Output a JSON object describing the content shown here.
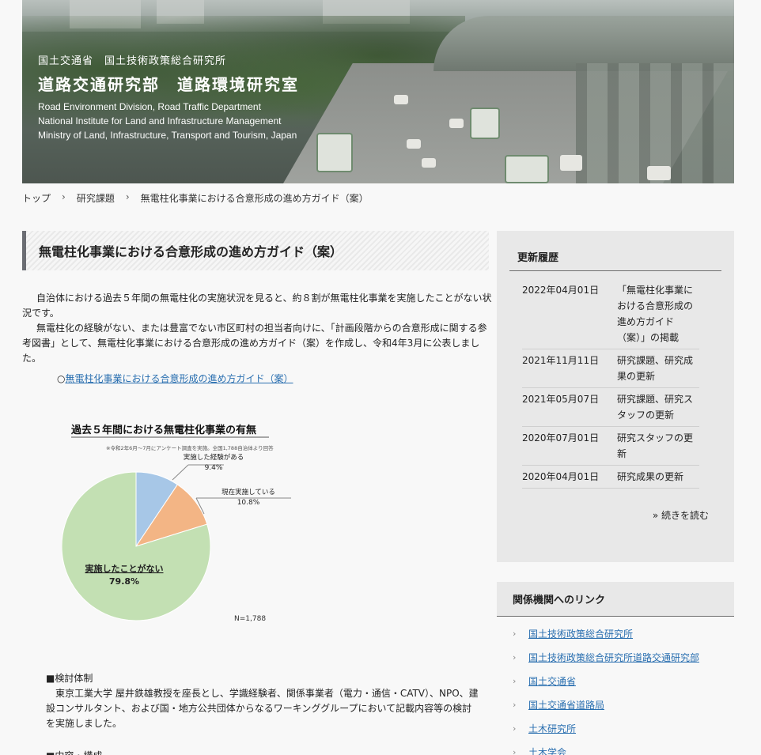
{
  "banner": {
    "org": "国土交通省　国土技術政策総合研究所",
    "dept": "道路交通研究部　道路環境研究室",
    "en_lines": [
      "Road Environment Division,  Road Traffic Department",
      "National Institute for Land and Infrastructure Management",
      "Ministry of Land, Infrastructure, Transport and Tourism, Japan"
    ]
  },
  "breadcrumb": {
    "items": [
      "トップ",
      "研究課題",
      "無電柱化事業における合意形成の進め方ガイド（案）"
    ],
    "sep": "›"
  },
  "main": {
    "title": "無電柱化事業における合意形成の進め方ガイド（案）",
    "intro": [
      "自治体における過去５年間の無電柱化の実施状況を見ると、約８割が無電柱化事業を実施したことがない状況です。",
      "無電柱化の経験がない、または豊富でない市区町村の担当者向けに、「計画段階からの合意形成に関する参考図書」として、無電柱化事業における合意形成の進め方ガイド（案）を作成し、令和4年3月に公表しました。"
    ],
    "guide_link_prefix": "○",
    "guide_link": "無電柱化事業における合意形成の進め方ガイド（案）",
    "section1_head": "■検討体制",
    "section1_body": "東京工業大学 屋井鉄雄教授を座長とし、学識経験者、関係事業者（電力・通信・CATV）、NPO、建設コンサルタント、および国・地方公共団体からなるワーキンググループにおいて記載内容等の検討を実施しました。",
    "section2_head": "■内容・構成"
  },
  "chart_data": {
    "type": "pie",
    "title": "過去５年間における無電柱化事業の有無",
    "subtitle": "※令和2年6月～7月にアンケート調査を実施。全国1,788自治体より回答",
    "categories": [
      "実施した経験がある",
      "現在実施している",
      "実施したことがない"
    ],
    "values": [
      9.4,
      10.8,
      79.8
    ],
    "labels": [
      "9.4%",
      "10.8%",
      "79.8%"
    ],
    "colors": [
      "#a7c7e7",
      "#f3b585",
      "#c3e0b3"
    ],
    "note": "N=1,788"
  },
  "history": {
    "title": "更新履歴",
    "items": [
      {
        "date": "2022年04月01日",
        "text": "「無電柱化事業における合意形成の進め方ガイド（案）」の掲載"
      },
      {
        "date": "2021年11月11日",
        "text": "研究課題、研究成果の更新"
      },
      {
        "date": "2021年05月07日",
        "text": "研究課題、研究スタッフの更新"
      },
      {
        "date": "2020年07月01日",
        "text": "研究スタッフの更新"
      },
      {
        "date": "2020年04月01日",
        "text": "研究成果の更新"
      }
    ],
    "more": "» 続きを読む"
  },
  "links": {
    "title": "関係機関へのリンク",
    "arrow": "›",
    "items": [
      "国土技術政策総合研究所",
      "国土技術政策総合研究所道路交通研究部",
      "国土交通省",
      "国土交通省道路局",
      "土木研究所",
      "土木学会"
    ]
  }
}
